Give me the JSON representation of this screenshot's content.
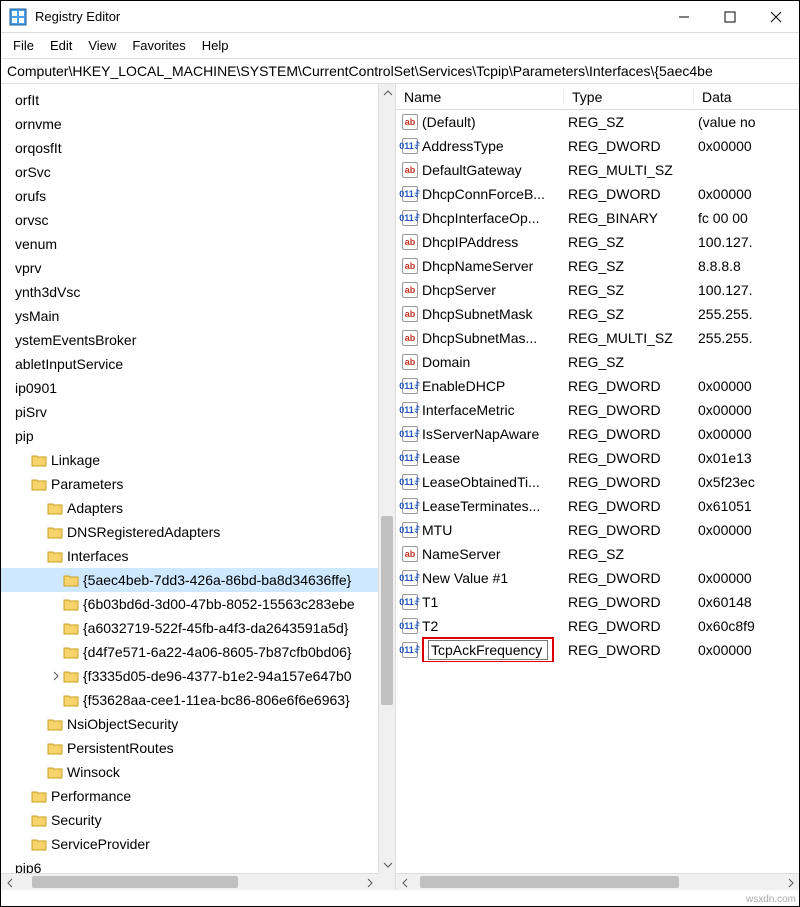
{
  "window": {
    "title": "Registry Editor"
  },
  "menu": {
    "file": "File",
    "edit": "Edit",
    "view": "View",
    "favorites": "Favorites",
    "help": "Help"
  },
  "address": "Computer\\HKEY_LOCAL_MACHINE\\SYSTEM\\CurrentControlSet\\Services\\Tcpip\\Parameters\\Interfaces\\{5aec4be",
  "tree": [
    {
      "label": "orfIt",
      "indent": 0,
      "icon": false
    },
    {
      "label": "ornvme",
      "indent": 0,
      "icon": false
    },
    {
      "label": "orqosfIt",
      "indent": 0,
      "icon": false
    },
    {
      "label": "orSvc",
      "indent": 0,
      "icon": false
    },
    {
      "label": "orufs",
      "indent": 0,
      "icon": false
    },
    {
      "label": "orvsc",
      "indent": 0,
      "icon": false
    },
    {
      "label": "venum",
      "indent": 0,
      "icon": false
    },
    {
      "label": "vprv",
      "indent": 0,
      "icon": false
    },
    {
      "label": "ynth3dVsc",
      "indent": 0,
      "icon": false
    },
    {
      "label": "ysMain",
      "indent": 0,
      "icon": false
    },
    {
      "label": "ystemEventsBroker",
      "indent": 0,
      "icon": false
    },
    {
      "label": "abletInputService",
      "indent": 0,
      "icon": false
    },
    {
      "label": "ip0901",
      "indent": 0,
      "icon": false
    },
    {
      "label": "piSrv",
      "indent": 0,
      "icon": false
    },
    {
      "label": "pip",
      "indent": 0,
      "icon": false
    },
    {
      "label": "Linkage",
      "indent": 1,
      "icon": true
    },
    {
      "label": "Parameters",
      "indent": 1,
      "icon": true,
      "open": true
    },
    {
      "label": "Adapters",
      "indent": 2,
      "icon": true
    },
    {
      "label": "DNSRegisteredAdapters",
      "indent": 2,
      "icon": true
    },
    {
      "label": "Interfaces",
      "indent": 2,
      "icon": true,
      "open": true
    },
    {
      "label": "{5aec4beb-7dd3-426a-86bd-ba8d34636ffe}",
      "indent": 3,
      "icon": true,
      "selected": true
    },
    {
      "label": "{6b03bd6d-3d00-47bb-8052-15563c283ebe",
      "indent": 3,
      "icon": true
    },
    {
      "label": "{a6032719-522f-45fb-a4f3-da2643591a5d}",
      "indent": 3,
      "icon": true
    },
    {
      "label": "{d4f7e571-6a22-4a06-8605-7b87cfb0bd06}",
      "indent": 3,
      "icon": true
    },
    {
      "label": "{f3335d05-de96-4377-b1e2-94a157e647b0",
      "indent": 3,
      "icon": true,
      "expander": ">"
    },
    {
      "label": "{f53628aa-cee1-11ea-bc86-806e6f6e6963}",
      "indent": 3,
      "icon": true
    },
    {
      "label": "NsiObjectSecurity",
      "indent": 2,
      "icon": true
    },
    {
      "label": "PersistentRoutes",
      "indent": 2,
      "icon": true
    },
    {
      "label": "Winsock",
      "indent": 2,
      "icon": true
    },
    {
      "label": "Performance",
      "indent": 1,
      "icon": true
    },
    {
      "label": "Security",
      "indent": 1,
      "icon": true
    },
    {
      "label": "ServiceProvider",
      "indent": 1,
      "icon": true
    },
    {
      "label": "pip6",
      "indent": 0,
      "icon": false
    }
  ],
  "list": {
    "headers": {
      "name": "Name",
      "type": "Type",
      "data": "Data"
    },
    "rows": [
      {
        "icon": "ab",
        "name": "(Default)",
        "type": "REG_SZ",
        "data": "(value no"
      },
      {
        "icon": "011",
        "name": "AddressType",
        "type": "REG_DWORD",
        "data": "0x00000"
      },
      {
        "icon": "ab",
        "name": "DefaultGateway",
        "type": "REG_MULTI_SZ",
        "data": ""
      },
      {
        "icon": "011",
        "name": "DhcpConnForceB...",
        "type": "REG_DWORD",
        "data": "0x00000"
      },
      {
        "icon": "011",
        "name": "DhcpInterfaceOp...",
        "type": "REG_BINARY",
        "data": "fc 00 00 "
      },
      {
        "icon": "ab",
        "name": "DhcpIPAddress",
        "type": "REG_SZ",
        "data": "100.127."
      },
      {
        "icon": "ab",
        "name": "DhcpNameServer",
        "type": "REG_SZ",
        "data": "8.8.8.8"
      },
      {
        "icon": "ab",
        "name": "DhcpServer",
        "type": "REG_SZ",
        "data": "100.127."
      },
      {
        "icon": "ab",
        "name": "DhcpSubnetMask",
        "type": "REG_SZ",
        "data": "255.255."
      },
      {
        "icon": "ab",
        "name": "DhcpSubnetMas...",
        "type": "REG_MULTI_SZ",
        "data": "255.255."
      },
      {
        "icon": "ab",
        "name": "Domain",
        "type": "REG_SZ",
        "data": ""
      },
      {
        "icon": "011",
        "name": "EnableDHCP",
        "type": "REG_DWORD",
        "data": "0x00000"
      },
      {
        "icon": "011",
        "name": "InterfaceMetric",
        "type": "REG_DWORD",
        "data": "0x00000"
      },
      {
        "icon": "011",
        "name": "IsServerNapAware",
        "type": "REG_DWORD",
        "data": "0x00000"
      },
      {
        "icon": "011",
        "name": "Lease",
        "type": "REG_DWORD",
        "data": "0x01e13"
      },
      {
        "icon": "011",
        "name": "LeaseObtainedTi...",
        "type": "REG_DWORD",
        "data": "0x5f23ec"
      },
      {
        "icon": "011",
        "name": "LeaseTerminates...",
        "type": "REG_DWORD",
        "data": "0x61051"
      },
      {
        "icon": "011",
        "name": "MTU",
        "type": "REG_DWORD",
        "data": "0x00000"
      },
      {
        "icon": "ab",
        "name": "NameServer",
        "type": "REG_SZ",
        "data": ""
      },
      {
        "icon": "011",
        "name": "New Value #1",
        "type": "REG_DWORD",
        "data": "0x00000"
      },
      {
        "icon": "011",
        "name": "T1",
        "type": "REG_DWORD",
        "data": "0x60148"
      },
      {
        "icon": "011",
        "name": "T2",
        "type": "REG_DWORD",
        "data": "0x60c8f9"
      },
      {
        "icon": "011",
        "name": "TcpAckFrequency",
        "type": "REG_DWORD",
        "data": "0x00000",
        "editing": true
      }
    ]
  },
  "watermark": "wsxdn.com"
}
